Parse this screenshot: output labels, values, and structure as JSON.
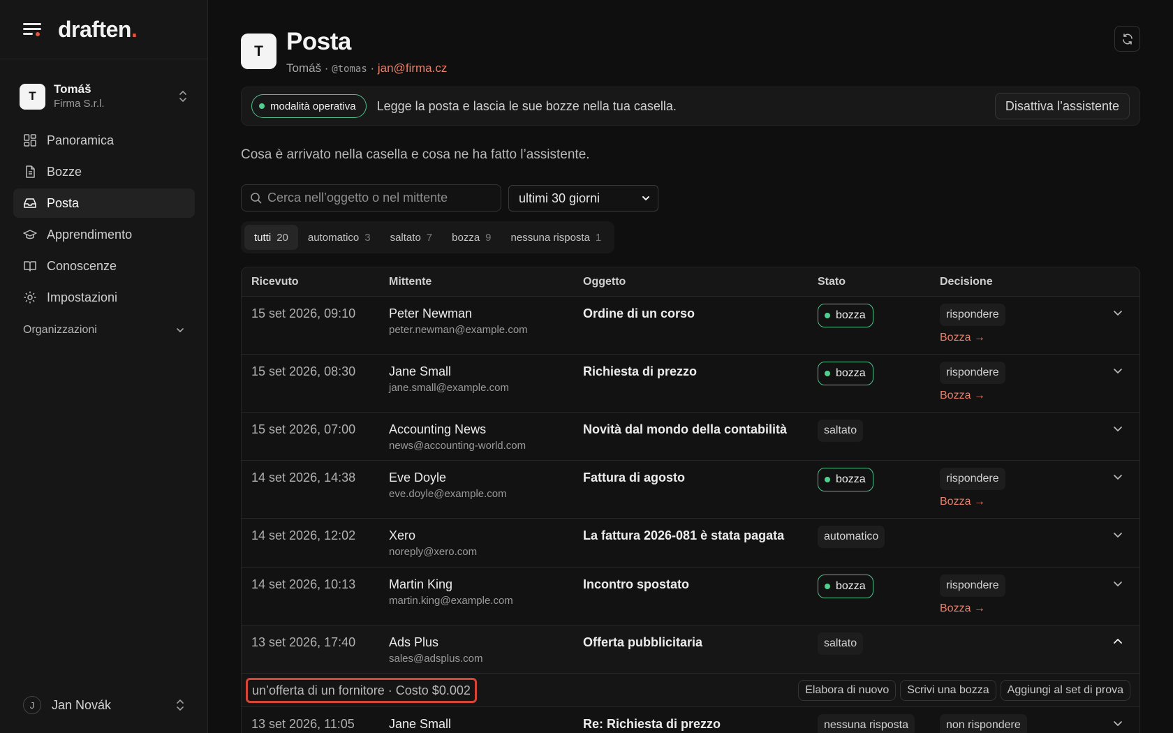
{
  "sidebar": {
    "logo": "draften",
    "logo_dot": ".",
    "account": {
      "initial": "T",
      "name": "Tomáš",
      "org": "Firma S.r.l."
    },
    "nav": [
      {
        "label": "Panoramica",
        "icon": "dashboard-icon"
      },
      {
        "label": "Bozze",
        "icon": "document-icon"
      },
      {
        "label": "Posta",
        "icon": "inbox-icon",
        "active": true
      },
      {
        "label": "Apprendimento",
        "icon": "graduation-cap-icon"
      },
      {
        "label": "Conoscenze",
        "icon": "book-icon"
      },
      {
        "label": "Impostazioni",
        "icon": "gear-icon"
      }
    ],
    "org_section": "Organizzazioni",
    "user": {
      "initial": "J",
      "name": "Jan Novák"
    }
  },
  "header": {
    "initial": "T",
    "title": "Posta",
    "name": "Tomáš",
    "sep1": " · ",
    "handle": "@tomas",
    "sep2": " · ",
    "email": "jan@firma.cz"
  },
  "banner": {
    "mode": "modalità operativa",
    "text": "Legge la posta e lascia le sue bozze nella tua casella.",
    "button": "Disattiva l’assistente"
  },
  "description": "Cosa è arrivato nella casella e cosa ne ha fatto l’assistente.",
  "search": {
    "placeholder": "Cerca nell’oggetto o nel mittente"
  },
  "period": {
    "selected": "ultimi 30 giorni"
  },
  "tabs": [
    {
      "label": "tutti",
      "count": "20",
      "active": true
    },
    {
      "label": "automatico",
      "count": "3"
    },
    {
      "label": "saltato",
      "count": "7"
    },
    {
      "label": "bozza",
      "count": "9"
    },
    {
      "label": "nessuna risposta",
      "count": "1"
    }
  ],
  "table": {
    "columns": [
      "Ricevuto",
      "Mittente",
      "Oggetto",
      "Stato",
      "Decisione"
    ],
    "rows": [
      {
        "date": "15 set 2026, 09:10",
        "name": "Peter Newman",
        "email": "peter.newman@example.com",
        "subject": "Ordine di un corso",
        "status": "bozza",
        "decision": "rispondere",
        "link": "Bozza →"
      },
      {
        "date": "15 set 2026, 08:30",
        "name": "Jane Small",
        "email": "jane.small@example.com",
        "subject": "Richiesta di prezzo",
        "status": "bozza",
        "decision": "rispondere",
        "link": "Bozza →"
      },
      {
        "date": "15 set 2026, 07:00",
        "name": "Accounting News",
        "email": "news@accounting-world.com",
        "subject": "Novità dal mondo della contabilità",
        "status": "saltato"
      },
      {
        "date": "14 set 2026, 14:38",
        "name": "Eve Doyle",
        "email": "eve.doyle@example.com",
        "subject": "Fattura di agosto",
        "status": "bozza",
        "decision": "rispondere",
        "link": "Bozza →"
      },
      {
        "date": "14 set 2026, 12:02",
        "name": "Xero",
        "email": "noreply@xero.com",
        "subject": "La fattura 2026-081 è stata pagata",
        "status": "automatico"
      },
      {
        "date": "14 set 2026, 10:13",
        "name": "Martin King",
        "email": "martin.king@example.com",
        "subject": "Incontro spostato",
        "status": "bozza",
        "decision": "rispondere",
        "link": "Bozza →"
      },
      {
        "date": "13 set 2026, 17:40",
        "name": "Ads Plus",
        "email": "sales@adsplus.com",
        "subject": "Offerta pubblicitaria",
        "status": "saltato",
        "expanded": true
      },
      {
        "date": "13 set 2026, 11:05",
        "name": "Jane Small",
        "email": "",
        "subject": "Re: Richiesta di prezzo",
        "status": "nessuna risposta",
        "decision": "non rispondere"
      }
    ],
    "expanded_info": "un’offerta di un fornitore · Costo $0.002",
    "expanded_actions": [
      "Elabora di nuovo",
      "Scrivi una bozza",
      "Aggiungi al set di prova"
    ]
  },
  "colors": {
    "accent": "#e5533d",
    "link": "#e8826c",
    "status_green": "#4fbf8b"
  }
}
